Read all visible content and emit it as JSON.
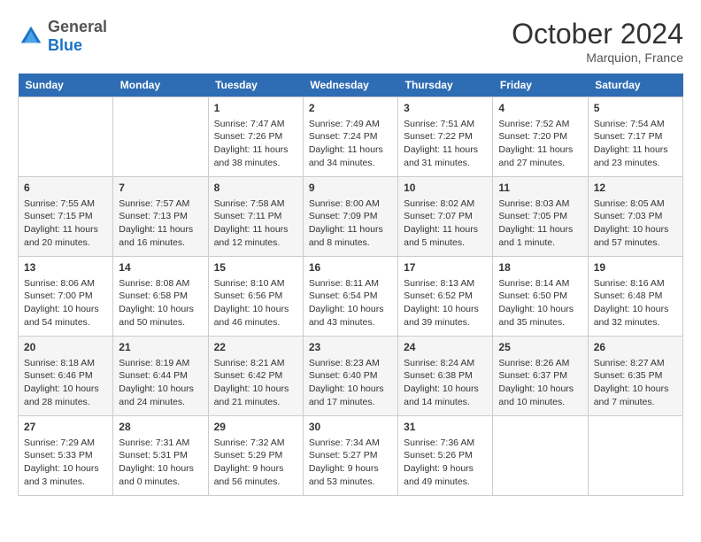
{
  "header": {
    "logo_line1": "General",
    "logo_line2": "Blue",
    "month": "October 2024",
    "location": "Marquion, France"
  },
  "weekdays": [
    "Sunday",
    "Monday",
    "Tuesday",
    "Wednesday",
    "Thursday",
    "Friday",
    "Saturday"
  ],
  "weeks": [
    [
      {
        "day": "",
        "info": ""
      },
      {
        "day": "",
        "info": ""
      },
      {
        "day": "1",
        "info": "Sunrise: 7:47 AM\nSunset: 7:26 PM\nDaylight: 11 hours and 38 minutes."
      },
      {
        "day": "2",
        "info": "Sunrise: 7:49 AM\nSunset: 7:24 PM\nDaylight: 11 hours and 34 minutes."
      },
      {
        "day": "3",
        "info": "Sunrise: 7:51 AM\nSunset: 7:22 PM\nDaylight: 11 hours and 31 minutes."
      },
      {
        "day": "4",
        "info": "Sunrise: 7:52 AM\nSunset: 7:20 PM\nDaylight: 11 hours and 27 minutes."
      },
      {
        "day": "5",
        "info": "Sunrise: 7:54 AM\nSunset: 7:17 PM\nDaylight: 11 hours and 23 minutes."
      }
    ],
    [
      {
        "day": "6",
        "info": "Sunrise: 7:55 AM\nSunset: 7:15 PM\nDaylight: 11 hours and 20 minutes."
      },
      {
        "day": "7",
        "info": "Sunrise: 7:57 AM\nSunset: 7:13 PM\nDaylight: 11 hours and 16 minutes."
      },
      {
        "day": "8",
        "info": "Sunrise: 7:58 AM\nSunset: 7:11 PM\nDaylight: 11 hours and 12 minutes."
      },
      {
        "day": "9",
        "info": "Sunrise: 8:00 AM\nSunset: 7:09 PM\nDaylight: 11 hours and 8 minutes."
      },
      {
        "day": "10",
        "info": "Sunrise: 8:02 AM\nSunset: 7:07 PM\nDaylight: 11 hours and 5 minutes."
      },
      {
        "day": "11",
        "info": "Sunrise: 8:03 AM\nSunset: 7:05 PM\nDaylight: 11 hours and 1 minute."
      },
      {
        "day": "12",
        "info": "Sunrise: 8:05 AM\nSunset: 7:03 PM\nDaylight: 10 hours and 57 minutes."
      }
    ],
    [
      {
        "day": "13",
        "info": "Sunrise: 8:06 AM\nSunset: 7:00 PM\nDaylight: 10 hours and 54 minutes."
      },
      {
        "day": "14",
        "info": "Sunrise: 8:08 AM\nSunset: 6:58 PM\nDaylight: 10 hours and 50 minutes."
      },
      {
        "day": "15",
        "info": "Sunrise: 8:10 AM\nSunset: 6:56 PM\nDaylight: 10 hours and 46 minutes."
      },
      {
        "day": "16",
        "info": "Sunrise: 8:11 AM\nSunset: 6:54 PM\nDaylight: 10 hours and 43 minutes."
      },
      {
        "day": "17",
        "info": "Sunrise: 8:13 AM\nSunset: 6:52 PM\nDaylight: 10 hours and 39 minutes."
      },
      {
        "day": "18",
        "info": "Sunrise: 8:14 AM\nSunset: 6:50 PM\nDaylight: 10 hours and 35 minutes."
      },
      {
        "day": "19",
        "info": "Sunrise: 8:16 AM\nSunset: 6:48 PM\nDaylight: 10 hours and 32 minutes."
      }
    ],
    [
      {
        "day": "20",
        "info": "Sunrise: 8:18 AM\nSunset: 6:46 PM\nDaylight: 10 hours and 28 minutes."
      },
      {
        "day": "21",
        "info": "Sunrise: 8:19 AM\nSunset: 6:44 PM\nDaylight: 10 hours and 24 minutes."
      },
      {
        "day": "22",
        "info": "Sunrise: 8:21 AM\nSunset: 6:42 PM\nDaylight: 10 hours and 21 minutes."
      },
      {
        "day": "23",
        "info": "Sunrise: 8:23 AM\nSunset: 6:40 PM\nDaylight: 10 hours and 17 minutes."
      },
      {
        "day": "24",
        "info": "Sunrise: 8:24 AM\nSunset: 6:38 PM\nDaylight: 10 hours and 14 minutes."
      },
      {
        "day": "25",
        "info": "Sunrise: 8:26 AM\nSunset: 6:37 PM\nDaylight: 10 hours and 10 minutes."
      },
      {
        "day": "26",
        "info": "Sunrise: 8:27 AM\nSunset: 6:35 PM\nDaylight: 10 hours and 7 minutes."
      }
    ],
    [
      {
        "day": "27",
        "info": "Sunrise: 7:29 AM\nSunset: 5:33 PM\nDaylight: 10 hours and 3 minutes."
      },
      {
        "day": "28",
        "info": "Sunrise: 7:31 AM\nSunset: 5:31 PM\nDaylight: 10 hours and 0 minutes."
      },
      {
        "day": "29",
        "info": "Sunrise: 7:32 AM\nSunset: 5:29 PM\nDaylight: 9 hours and 56 minutes."
      },
      {
        "day": "30",
        "info": "Sunrise: 7:34 AM\nSunset: 5:27 PM\nDaylight: 9 hours and 53 minutes."
      },
      {
        "day": "31",
        "info": "Sunrise: 7:36 AM\nSunset: 5:26 PM\nDaylight: 9 hours and 49 minutes."
      },
      {
        "day": "",
        "info": ""
      },
      {
        "day": "",
        "info": ""
      }
    ]
  ]
}
